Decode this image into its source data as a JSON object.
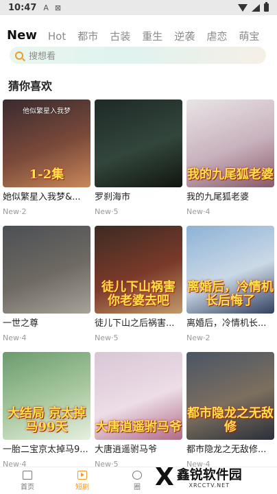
{
  "status_bar": {
    "time": "10:47",
    "icon_a": "A",
    "icon_b": "⊠"
  },
  "tabs": [
    "New",
    "Hot",
    "都市",
    "古装",
    "重生",
    "逆袭",
    "虐恋",
    "萌宝"
  ],
  "search": {
    "placeholder": "搜想看"
  },
  "section_title": "猜你喜欢",
  "cards": [
    {
      "title": "她似繁星入我梦&...",
      "meta": "New·2",
      "poster_text": "1-2集",
      "poster_sub": "他似繁星入我梦",
      "colors": [
        "#3a2a2e",
        "#7a4a3a",
        "#c9885a"
      ]
    },
    {
      "title": "罗刹海市",
      "meta": "New·5",
      "poster_text": "",
      "poster_sub": "",
      "colors": [
        "#1d2a26",
        "#33463c",
        "#10150f"
      ]
    },
    {
      "title": "我的九尾狐老婆",
      "meta": "New·4",
      "poster_text": "我的九尾狐老婆",
      "poster_sub": "",
      "colors": [
        "#e9e4e6",
        "#c8b2bd",
        "#8a5a6a"
      ]
    },
    {
      "title": "一世之尊",
      "meta": "New·4",
      "poster_text": "",
      "poster_sub": "",
      "colors": [
        "#4b4f55",
        "#6f6a62",
        "#a7a29a"
      ]
    },
    {
      "title": "徒儿下山之后祸害...",
      "meta": "New·5",
      "poster_text": "徒儿下山祸害 你老婆去吧",
      "poster_sub": "",
      "colors": [
        "#3c2b22",
        "#7b3a2a",
        "#c29a6a"
      ]
    },
    {
      "title": "离婚后，冷情机长...",
      "meta": "New·2",
      "poster_text": "离婚后，冷情机长后悔了",
      "poster_sub": "",
      "colors": [
        "#8db2d6",
        "#cbd9e6",
        "#334060"
      ]
    },
    {
      "title": "一胎二宝京太掉马9...",
      "meta": "New·4",
      "poster_text": "大结局 京太掉马99天",
      "poster_sub": "",
      "colors": [
        "#6b9b6f",
        "#a9c9a0",
        "#e6efe0"
      ]
    },
    {
      "title": "大唐逍遥驸马爷",
      "meta": "New·5",
      "poster_text": "大唐逍遥驸马爷",
      "poster_sub": "",
      "colors": [
        "#d9c6d6",
        "#ecdde6",
        "#b06a86"
      ]
    },
    {
      "title": "都市隐龙之无敌修...",
      "meta": "New·4",
      "poster_text": "都市隐龙之无敌修",
      "poster_sub": "",
      "colors": [
        "#4a5566",
        "#7c6f5e",
        "#2a2f3a"
      ]
    }
  ],
  "nav": [
    "首页",
    "短剧",
    "圈"
  ],
  "watermark": {
    "mark": "X",
    "name": "鑫锐软件园",
    "url": "XRCCTV.NET"
  }
}
